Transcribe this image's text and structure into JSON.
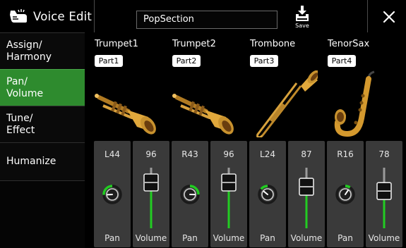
{
  "header": {
    "title": "Voice Edit",
    "voice_name": "PopSection",
    "save_label": "Save",
    "close_label": "×"
  },
  "tabs": [
    {
      "label": "Assign/\nHarmony",
      "active": false
    },
    {
      "label": "Pan/\nVolume",
      "active": true
    },
    {
      "label": "Tune/\nEffect",
      "active": false
    },
    {
      "label": "Humanize",
      "active": false
    }
  ],
  "parts": [
    {
      "name": "Trumpet1",
      "badge": "Part1",
      "instrument": "trumpet",
      "pan": "L44",
      "pan_value": -44,
      "volume": "96",
      "volume_value": 96
    },
    {
      "name": "Trumpet2",
      "badge": "Part2",
      "instrument": "trumpet",
      "pan": "R43",
      "pan_value": 43,
      "volume": "96",
      "volume_value": 96
    },
    {
      "name": "Trombone",
      "badge": "Part3",
      "instrument": "trombone",
      "pan": "L24",
      "pan_value": -24,
      "volume": "87",
      "volume_value": 87
    },
    {
      "name": "TenorSax",
      "badge": "Part4",
      "instrument": "saxophone",
      "pan": "R16",
      "pan_value": 16,
      "volume": "78",
      "volume_value": 78
    }
  ],
  "labels": {
    "pan": "Pan",
    "volume": "Volume"
  },
  "colors": {
    "accent": "#2e8b2e",
    "level": "#22cc22",
    "panel": "#3a3a3a",
    "brass": "#c8922e"
  }
}
